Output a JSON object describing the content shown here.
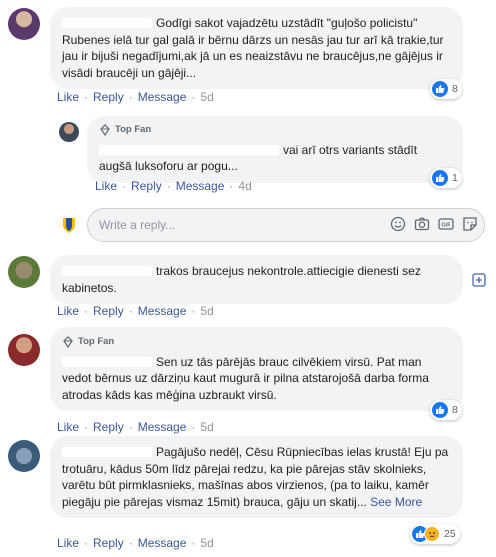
{
  "comments": [
    {
      "text": "Godīgi sakot vajadzētu uzstādīt \"guļošo policistu\" Rubenes ielā tur gal galā ir bērnu dārzs un nesās jau tur arī kā trakie,tur jau ir bijuši negadījumi,ak jā un es neaizstāvu ne braucējus,ne gājējus ir visādi braucēji un gājēji...",
      "like": "Like",
      "reply": "Reply",
      "message": "Message",
      "time": "5d",
      "reaction_count": "8"
    },
    {
      "badge": "Top Fan",
      "text": "vai arī otrs variants stādīt augšā luksoforu ar pogu...",
      "like": "Like",
      "reply": "Reply",
      "message": "Message",
      "time": "4d",
      "reaction_count": "1"
    },
    {
      "text": "trakos braucejus nekontrole.attiecigie dienesti sez kabinetos.",
      "like": "Like",
      "reply": "Reply",
      "message": "Message",
      "time": "5d"
    },
    {
      "badge": "Top Fan",
      "text": "Sen uz tās pārējās brauc cilvēkiem virsū. Pat man vedot bērnus uz dārziņu kaut mugurā ir pilna atstarojošā darba forma atrodas kāds kas mēģina uzbraukt virsū.",
      "like": "Like",
      "reply": "Reply",
      "message": "Message",
      "time": "5d",
      "reaction_count": "8"
    },
    {
      "text": "Pagājušo nedēļ, Cēsu Rūpniecības ielas krustā! Eju pa trotuāru, kādus 50m līdz pārejai redzu, ka pie pārejas stāv skolnieks, varētu būt pirmklasnieks, mašīnas abos virzienos, (pa to laiku, kamēr piegāju pie pārejas vismaz 15mit) brauca, gāju un skatij...",
      "see_more": "See More",
      "like": "Like",
      "reply": "Reply",
      "message": "Message",
      "time": "5d",
      "reaction_count": "25"
    }
  ],
  "reply_box": {
    "placeholder": "Write a reply..."
  },
  "colors": {
    "link": "#385898",
    "bubble": "#f2f3f5",
    "like_blue": "#1877f2"
  }
}
